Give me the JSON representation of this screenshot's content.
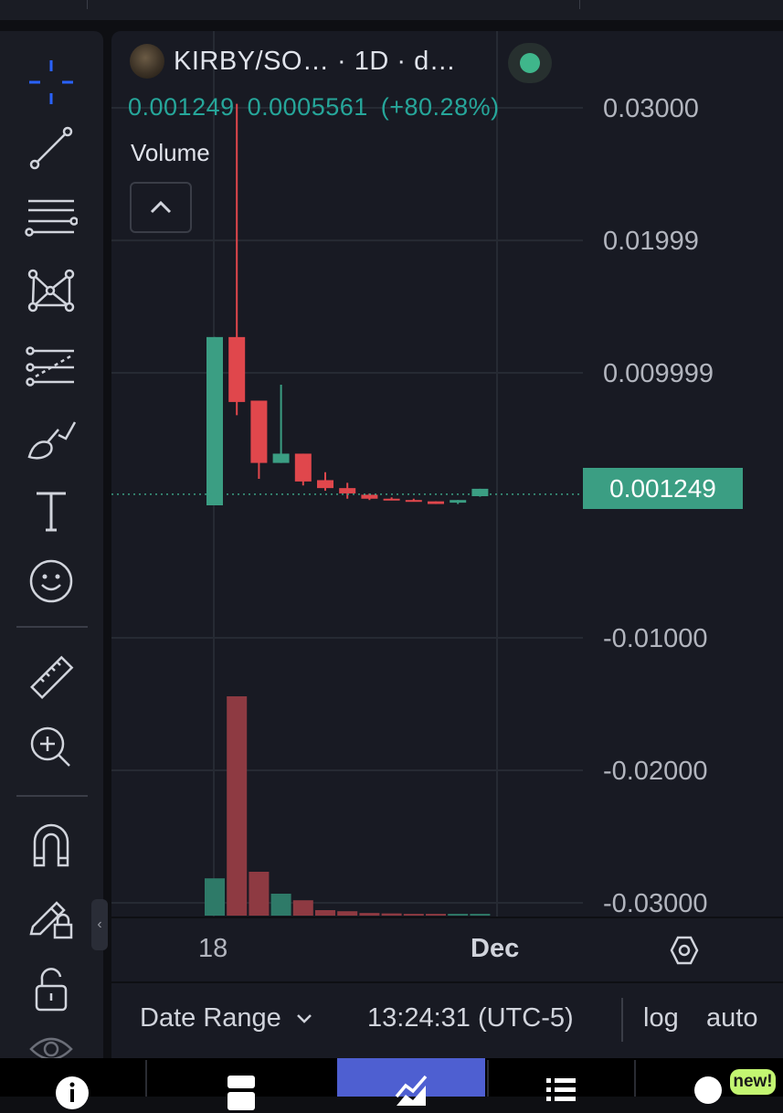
{
  "header": {
    "symbol": "KIRBY/SO…  · 1D · d…",
    "price": "0.001249",
    "change": "0.0005561",
    "change_pct": "(+80.28%)"
  },
  "volume_label": "Volume",
  "price_label": "0.001249",
  "bottom_bar": {
    "date_range": "Date Range",
    "time": "13:24:31 (UTC-5)",
    "log": "log",
    "auto": "auto"
  },
  "nav": {
    "new_badge": "new!"
  },
  "colors": {
    "up": "#26a69a",
    "down": "#ef5350",
    "accent": "#2962ff",
    "nav_active": "#4e5fd1"
  },
  "tools": [
    "crosshair-icon",
    "trend-line-icon",
    "fib-retracement-icon",
    "pattern-icon",
    "forecast-icon",
    "brush-icon",
    "text-icon",
    "emoji-icon",
    "ruler-icon",
    "zoom-in-icon",
    "magnet-icon",
    "lock-drawing-icon",
    "unlock-icon",
    "eye-icon"
  ],
  "chart_data": {
    "type": "candlestick",
    "x_labels": [
      "18",
      "Dec"
    ],
    "y_ticks": [
      0.03,
      0.01999,
      0.009999,
      -0.01,
      -0.02,
      -0.03
    ],
    "y_tick_labels": [
      "0.03000",
      "0.01999",
      "0.009999",
      "-0.01000",
      "-0.02000",
      "-0.03000"
    ],
    "ylim": [
      -0.03,
      0.03
    ],
    "current_price": 0.001249,
    "candles": [
      {
        "o": 0.0,
        "h": 0.0127,
        "l": 0.0,
        "c": 0.0127
      },
      {
        "o": 0.0127,
        "h": 0.0303,
        "l": 0.0068,
        "c": 0.0078
      },
      {
        "o": 0.0079,
        "h": 0.0079,
        "l": 0.002,
        "c": 0.0032
      },
      {
        "o": 0.0032,
        "h": 0.0091,
        "l": 0.0032,
        "c": 0.0039
      },
      {
        "o": 0.0039,
        "h": 0.0039,
        "l": 0.0015,
        "c": 0.0018
      },
      {
        "o": 0.0019,
        "h": 0.0025,
        "l": 0.0011,
        "c": 0.0013
      },
      {
        "o": 0.0013,
        "h": 0.0017,
        "l": 0.0005,
        "c": 0.0009
      },
      {
        "o": 0.0008,
        "h": 0.0009,
        "l": 0.0004,
        "c": 0.0005
      },
      {
        "o": 0.0005,
        "h": 0.0006,
        "l": 0.0004,
        "c": 0.0004
      },
      {
        "o": 0.0004,
        "h": 0.0005,
        "l": 0.0003,
        "c": 0.0003
      },
      {
        "o": 0.0003,
        "h": 0.0003,
        "l": 0.0001,
        "c": 0.0001
      },
      {
        "o": 0.0002,
        "h": 0.0004,
        "l": 0.0001,
        "c": 0.0004
      },
      {
        "o": 0.00069,
        "h": 0.00125,
        "l": 0.00065,
        "c": 0.001249
      }
    ],
    "volume_heights": [
      0.17,
      1.0,
      0.2,
      0.1,
      0.07,
      0.025,
      0.02,
      0.012,
      0.01,
      0.008,
      0.008,
      0.008,
      0.008
    ]
  }
}
